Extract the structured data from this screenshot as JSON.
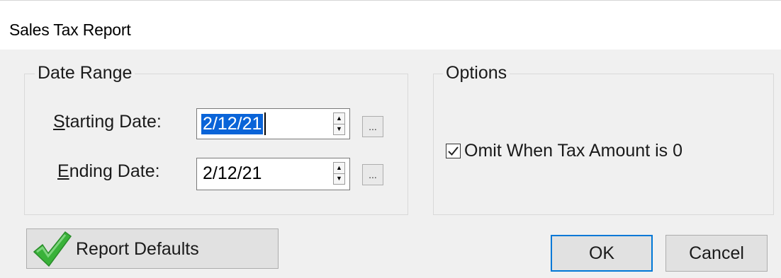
{
  "window": {
    "title": "Sales Tax Report"
  },
  "date_range": {
    "legend": "Date Range",
    "starting_label_mnemonic": "S",
    "starting_label_rest": "tarting Date:",
    "starting_value": "2/12/21",
    "ending_label_mnemonic": "E",
    "ending_label_rest": "nding Date:",
    "ending_value": "2/12/21",
    "ellipsis_label": "..."
  },
  "options": {
    "legend": "Options",
    "omit_zero_label": "Omit When Tax Amount is 0",
    "omit_zero_checked": true
  },
  "buttons": {
    "report_defaults": "Report Defaults",
    "ok": "OK",
    "cancel": "Cancel"
  },
  "colors": {
    "selection": "#0a64d8",
    "default_button_border": "#0078d7",
    "check_green": "#3ab23a"
  },
  "icons": {
    "report_defaults_icon": "green-checkmark-icon",
    "spinner_up": "triangle-up-icon",
    "spinner_down": "triangle-down-icon",
    "checkbox": "checkmark-icon"
  }
}
